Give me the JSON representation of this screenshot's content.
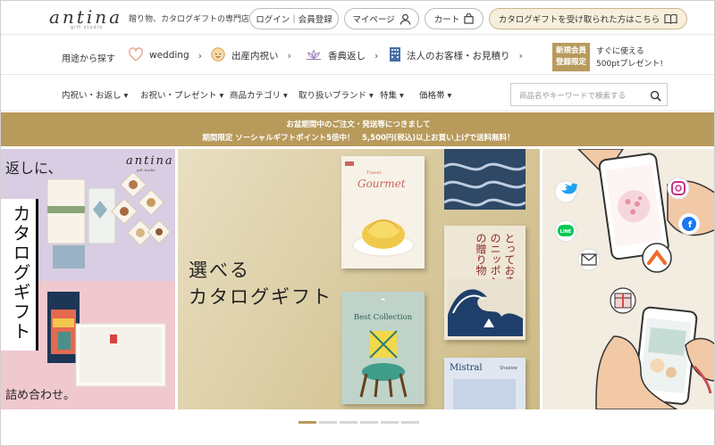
{
  "header": {
    "logo": "antina",
    "logo_sub": "gift studio",
    "tagline": "贈り物、カタログギフトの専門店",
    "login_label": "ログイン｜会員登録",
    "mypage_label": "マイページ",
    "cart_label": "カート",
    "receive_label": "カタログギフトを受け取られた方はこちら"
  },
  "purpose": {
    "lead": "用途から探す",
    "items": [
      {
        "label": "wedding",
        "icon": "heart-icon"
      },
      {
        "label": "出産内祝い",
        "icon": "baby-icon"
      },
      {
        "label": "香典返し",
        "icon": "lotus-icon"
      },
      {
        "label": "法人のお客様・お見積り",
        "icon": "building-icon"
      }
    ],
    "new_badge": [
      "新規会員",
      "登録限定"
    ],
    "new_text": [
      "すぐに使える",
      "500ptプレゼント!"
    ]
  },
  "nav": {
    "categories": [
      "内祝い・お返し ▾",
      "お祝い・プレゼント ▾",
      "商品カテゴリ ▾",
      "取り扱いブランド ▾",
      "特集 ▾",
      "価格帯 ▾"
    ],
    "search_placeholder": "商品名やキーワードで検索する"
  },
  "notice": {
    "line1": "お盆期間中のご注文・発送等につきまして",
    "line2": "期間限定 ソーシャルギフトポイント5倍中！　5,500円(税込)以上お買い上げで送料無料！"
  },
  "hero": {
    "left": {
      "top_text": "返しに、",
      "brand": "antina",
      "brand_sub": "gift studio",
      "vertical_title": "カタログギフト",
      "bottom_text": "詰め合わせ。"
    },
    "center": {
      "headline_1": "選べる",
      "headline_2": "カタログギフト",
      "book1_title": "Gourmet",
      "book1_small": "Travel",
      "book2_title": "Best Collection",
      "book3_title": "Mistral",
      "book3_sub": "Shadow",
      "book4_title": "とっておきのニッポンの贈り物"
    },
    "right": {
      "social_icons": [
        "twitter-icon",
        "instagram-icon",
        "line-icon",
        "facebook-icon",
        "mail-icon",
        "gift-icon"
      ]
    }
  },
  "carousel": {
    "slides": 6,
    "active": 0
  },
  "colors": {
    "accent": "#b89a5b",
    "notice_bg": "#b89a5b",
    "left_lavender": "#d9cde3",
    "left_pink": "#f0c9cf"
  }
}
